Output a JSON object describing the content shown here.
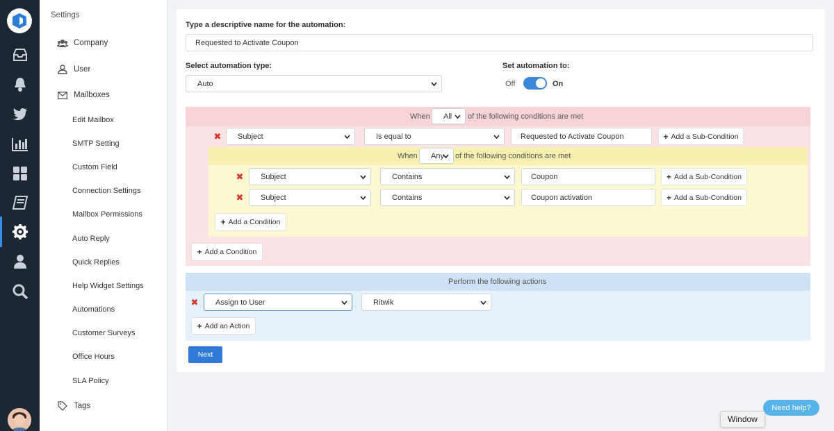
{
  "nav": {
    "title": "Settings",
    "items": [
      {
        "label": "Company",
        "icon": "users-icon"
      },
      {
        "label": "User",
        "icon": "user-icon"
      },
      {
        "label": "Mailboxes",
        "icon": "envelope-icon"
      }
    ],
    "subitems": [
      "Edit Mailbox",
      "SMTP Setting",
      "Custom Field",
      "Connection Settings",
      "Mailbox Permissions",
      "Auto Reply",
      "Quick Replies",
      "Help Widget Settings",
      "Automations",
      "Customer Surveys",
      "Office Hours",
      "SLA Policy"
    ],
    "tags": {
      "label": "Tags",
      "icon": "tag-icon"
    }
  },
  "rail": {
    "icons": [
      "inbox-icon",
      "bell-icon",
      "twitter-icon",
      "bar-chart-icon",
      "grid-icon",
      "book-icon",
      "gear-icon",
      "person-icon",
      "search-icon"
    ],
    "active": "gear-icon"
  },
  "form": {
    "name_label": "Type a descriptive name for the automation:",
    "name_value": "Requested to Activate Coupon",
    "type_label": "Select automation type:",
    "type_value": "Auto",
    "set_label": "Set automation to:",
    "toggle_off": "Off",
    "toggle_on": "On",
    "toggle_state": true
  },
  "conditions": {
    "when": "When",
    "match_all": "All",
    "suffix": "of the following conditions are met",
    "row": {
      "field": "Subject",
      "operator": "Is equal to",
      "value": "Requested to Activate Coupon",
      "sub_btn": "Add a Sub-Condition"
    },
    "sub": {
      "when": "When",
      "match": "Any",
      "suffix": "of the following conditions are met",
      "rows": [
        {
          "field": "Subject",
          "operator": "Contains",
          "value": "Coupon",
          "sub_btn": "Add a Sub-Condition"
        },
        {
          "field": "Subject",
          "operator": "Contains",
          "value": "Coupon activation",
          "sub_btn": "Add a Sub-Condition"
        }
      ],
      "add_btn": "Add a Condition"
    },
    "add_btn": "Add a Condition"
  },
  "actions": {
    "header": "Perform the following actions",
    "action": "Assign to User",
    "target": "Ritwik",
    "add_btn": "Add an Action"
  },
  "next_btn": "Next",
  "help_btn": "Need help?",
  "tooltip": "Window",
  "colors": {
    "rail": "#1d2733",
    "accent": "#2f7ad6",
    "pink": "#fbe3e5",
    "yellow": "#fcf8cf",
    "blue": "#e7f1fc",
    "remove": "#d9342b"
  }
}
